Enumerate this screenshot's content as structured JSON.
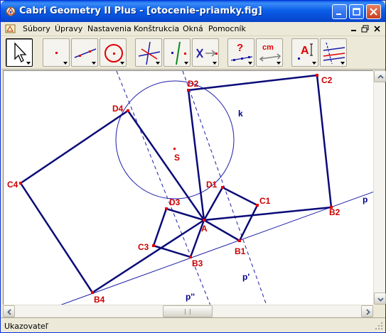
{
  "window": {
    "title": "Cabri Geometry II Plus - [otocenie-priamky.fig]"
  },
  "menu": {
    "items": [
      {
        "label": "Súbory"
      },
      {
        "label": "Úpravy"
      },
      {
        "label": "Nastavenia"
      },
      {
        "label": "Konštrukcia"
      },
      {
        "label": "Okná"
      },
      {
        "label": "Pomocník"
      }
    ]
  },
  "toolbar": {
    "tools": [
      {
        "name": "pointer-tool",
        "icon": "arrow-cursor-icon"
      },
      {
        "name": "point-tool",
        "icon": "point-icon"
      },
      {
        "name": "line-tool",
        "icon": "line-icon"
      },
      {
        "name": "curve-tool",
        "icon": "circle-icon"
      },
      {
        "name": "construct-tool",
        "icon": "perpendicular-icon"
      },
      {
        "name": "transform-tool",
        "icon": "reflection-icon"
      },
      {
        "name": "macro-tool",
        "icon": "macro-x-icon"
      },
      {
        "name": "check-property-tool",
        "icon": "question-icon"
      },
      {
        "name": "measure-tool",
        "icon": "measure-cm-icon"
      },
      {
        "name": "display-tool",
        "icon": "text-label-icon"
      },
      {
        "name": "draw-tool",
        "icon": "draw-style-icon"
      }
    ],
    "measure_text": "cm",
    "check_text": "?",
    "display_text": "A"
  },
  "figure": {
    "labels": {
      "A": "A",
      "S": "S",
      "k": "k",
      "B1": "B1",
      "B2": "B2",
      "B3": "B3",
      "B4": "B4",
      "C1": "C1",
      "C2": "C2",
      "C3": "C3",
      "C4": "C4",
      "D1": "D1",
      "D2": "D2",
      "D3": "D3",
      "D4": "D4",
      "p": "p",
      "p_prime": "p'",
      "p_double_prime": "p''"
    },
    "colors": {
      "polygon": "#0a0a78",
      "circle": "#1c1ca8",
      "line": "#1c1ca8",
      "point": "#e00000",
      "point_label": "#cc0000",
      "object_label": "#00008c"
    }
  },
  "status": {
    "text": "Ukazovateľ"
  }
}
